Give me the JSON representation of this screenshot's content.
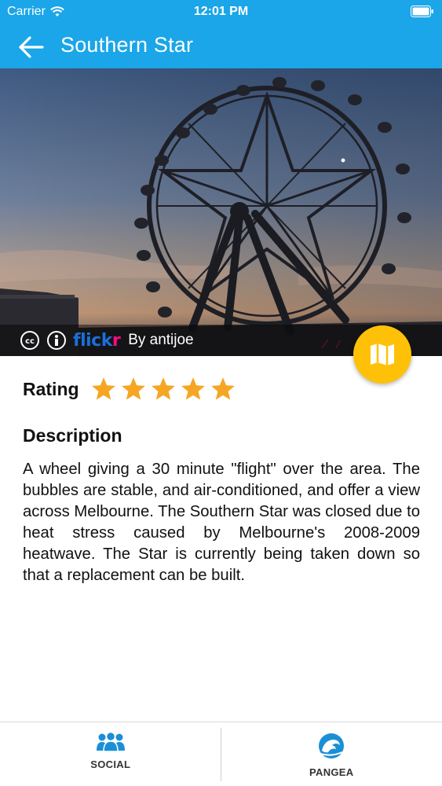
{
  "status_bar": {
    "carrier": "Carrier",
    "time": "12:01 PM"
  },
  "nav": {
    "title": "Southern Star",
    "back_icon": "arrow-left-icon",
    "color": "#1aa6e8"
  },
  "photo": {
    "subject": "ferris-wheel-at-dusk",
    "credit_by": "By antijoe",
    "flickr_part1": "flick",
    "flickr_part2": "r",
    "license_icons": [
      "creative-commons-icon",
      "attribution-icon"
    ]
  },
  "fab": {
    "icon": "map-icon",
    "color": "#ffc107"
  },
  "rating": {
    "label": "Rating",
    "stars": 5,
    "max_stars": 5,
    "star_color": "#f5a623"
  },
  "description": {
    "heading": "Description",
    "text": "A wheel giving a 30 minute \"flight\" over the area. The bubbles are stable, and air-conditioned, and offer a view across Melbourne. The Southern Star was closed due to heat stress caused by Melbourne's 2008-2009 heatwave. The Star is currently being taken down so that a replacement can be built."
  },
  "tabs": [
    {
      "label": "SOCIAL",
      "icon": "people-icon"
    },
    {
      "label": "PANGEA",
      "icon": "pangea-wave-icon"
    }
  ]
}
